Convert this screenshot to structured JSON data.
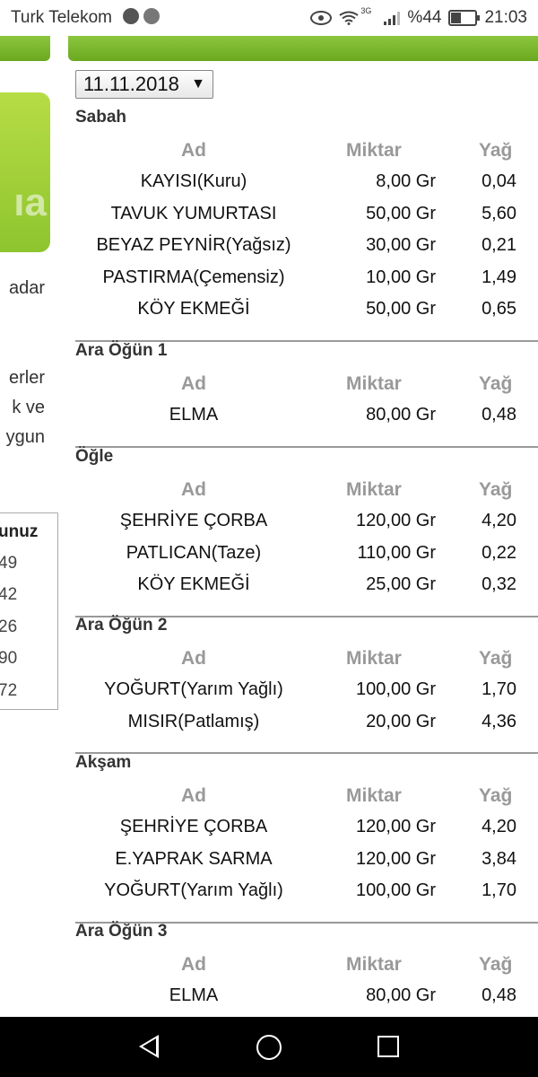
{
  "status_bar": {
    "carrier": "Turk Telekom",
    "battery": "%44",
    "time": "21:03",
    "network": "3G"
  },
  "left_panel": {
    "text_lines": [
      "adar",
      "erler",
      "k ve",
      "ygun"
    ],
    "box": {
      "header": "unuz",
      "values": [
        "49",
        "42",
        "26",
        "90",
        "72"
      ]
    }
  },
  "date": {
    "value": "11.11.2018"
  },
  "columns": {
    "name": "Ad",
    "qty": "Miktar",
    "fat": "Yağ"
  },
  "meals": [
    {
      "title": "Sabah",
      "rows": [
        {
          "name": "KAYISI(Kuru)",
          "qty": "8,00 Gr",
          "fat": "0,04"
        },
        {
          "name": "TAVUK YUMURTASI",
          "qty": "50,00 Gr",
          "fat": "5,60"
        },
        {
          "name": "BEYAZ PEYNİR(Yağsız)",
          "qty": "30,00 Gr",
          "fat": "0,21"
        },
        {
          "name": "PASTIRMA(Çemensiz)",
          "qty": "10,00 Gr",
          "fat": "1,49"
        },
        {
          "name": "KÖY EKMEĞİ",
          "qty": "50,00 Gr",
          "fat": "0,65"
        }
      ]
    },
    {
      "title": "Ara Öğün 1",
      "rows": [
        {
          "name": "ELMA",
          "qty": "80,00 Gr",
          "fat": "0,48"
        }
      ]
    },
    {
      "title": "Öğle",
      "rows": [
        {
          "name": "ŞEHRİYE ÇORBA",
          "qty": "120,00 Gr",
          "fat": "4,20"
        },
        {
          "name": "PATLICAN(Taze)",
          "qty": "110,00 Gr",
          "fat": "0,22"
        },
        {
          "name": "KÖY EKMEĞİ",
          "qty": "25,00 Gr",
          "fat": "0,32"
        }
      ]
    },
    {
      "title": "Ara Öğün 2",
      "rows": [
        {
          "name": "YOĞURT(Yarım Yağlı)",
          "qty": "100,00 Gr",
          "fat": "1,70"
        },
        {
          "name": "MISIR(Patlamış)",
          "qty": "20,00 Gr",
          "fat": "4,36"
        }
      ]
    },
    {
      "title": "Akşam",
      "rows": [
        {
          "name": "ŞEHRİYE ÇORBA",
          "qty": "120,00 Gr",
          "fat": "4,20"
        },
        {
          "name": "E.YAPRAK SARMA",
          "qty": "120,00 Gr",
          "fat": "3,84"
        },
        {
          "name": "YOĞURT(Yarım Yağlı)",
          "qty": "100,00 Gr",
          "fat": "1,70"
        }
      ]
    },
    {
      "title": "Ara Öğün 3",
      "rows": [
        {
          "name": "ELMA",
          "qty": "80,00 Gr",
          "fat": "0,48"
        }
      ]
    }
  ],
  "colors": {
    "accent_green": "#8cc63f",
    "banner_green": "#b7dc45",
    "header_gray": "#999999"
  },
  "nav": {
    "back_icon": "back-triangle-icon",
    "home_icon": "home-circle-icon",
    "recent_icon": "recent-square-icon"
  }
}
